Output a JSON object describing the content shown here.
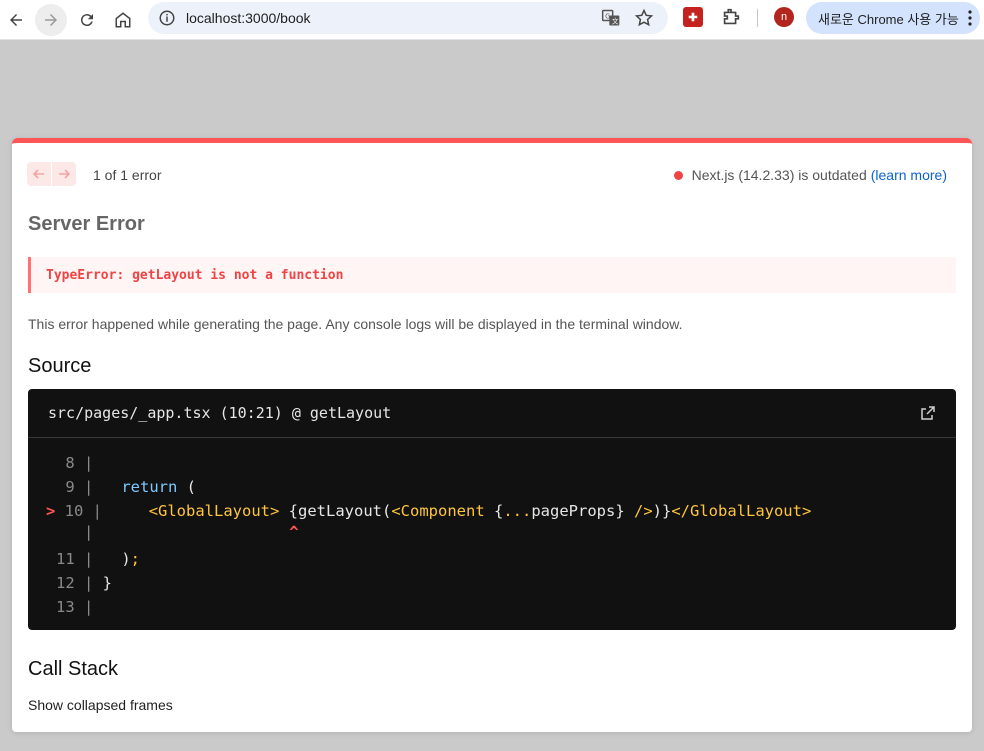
{
  "browser": {
    "url": "localhost:3000/book",
    "chrome_button_label": "새로운 Chrome 사용 가능",
    "avatar_initial": "n"
  },
  "overlay": {
    "error_count_text": "1 of 1 error",
    "version_text": "Next.js (14.2.33) is outdated",
    "learn_more_label": "(learn more)",
    "title": "Server Error",
    "error_message": "TypeError: getLayout is not a function",
    "description": "This error happened while generating the page. Any console logs will be displayed in the terminal window.",
    "source_heading": "Source",
    "source_file": "src/pages/_app.tsx (10:21) @ getLayout",
    "call_stack_heading": "Call Stack",
    "show_frames_label": "Show collapsed frames"
  },
  "code": {
    "gutter_8": "    8 |",
    "gutter_9": "    9 |",
    "gutter_10_arrow": ">",
    "gutter_10": " 10 |",
    "gutter_caret": "      |",
    "gutter_11": "   11 |",
    "gutter_12": "   12 |",
    "gutter_13": "   13 |",
    "l9_pre": "   ",
    "l9_kw": "return",
    "l9_post": " (",
    "l10_pre": "     ",
    "l10_tag_open": "<GlobalLayout>",
    "l10_mid1": " {getLayout(",
    "l10_comp": "<Component",
    "l10_mid2": " {",
    "l10_spread": "...",
    "l10_mid3": "pageProps} ",
    "l10_selfclose": "/>",
    "l10_mid4": ")}",
    "l10_tag_close": "</GlobalLayout>",
    "caret_pre": "                     ",
    "caret": "^",
    "l11_pre": "   ",
    "l11_paren": ")",
    "l11_semi": ";",
    "l12": " }"
  },
  "colors": {
    "error_red": "#ff5555",
    "link_blue": "#0b63ce",
    "code_bg": "#111111",
    "keyword": "#7ec9ff",
    "jsx_tag": "#ffc53d"
  },
  "icons": [
    "back-arrow-icon",
    "forward-arrow-icon",
    "reload-icon",
    "home-icon",
    "site-info-icon",
    "translate-icon",
    "bookmark-star-icon",
    "extension-icon",
    "puzzle-icon",
    "more-vert-icon",
    "prev-error-icon",
    "next-error-icon",
    "external-link-icon"
  ]
}
